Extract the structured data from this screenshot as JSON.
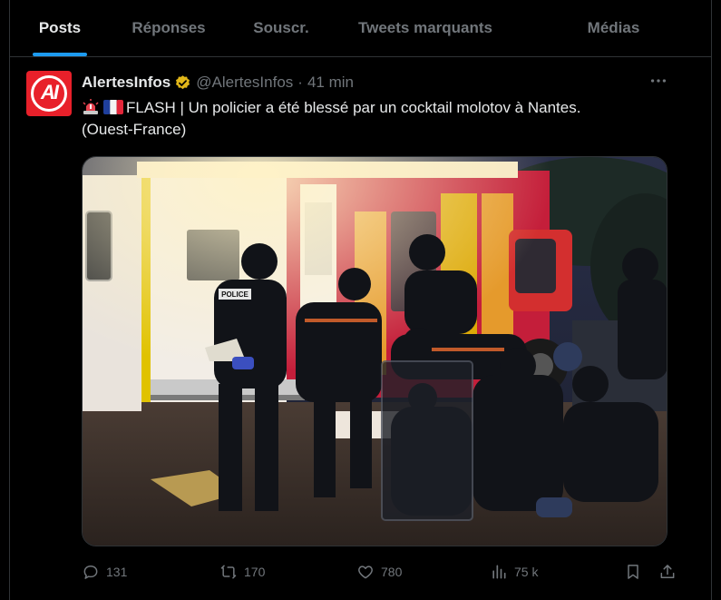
{
  "tabs": [
    {
      "label": "Posts",
      "active": true
    },
    {
      "label": "Réponses",
      "active": false
    },
    {
      "label": "Souscr.",
      "active": false
    },
    {
      "label": "Tweets marquants",
      "active": false
    },
    {
      "label": "Médias",
      "active": false
    }
  ],
  "tweet": {
    "avatar_text": "AI",
    "author_name": "AlertesInfos",
    "handle": "@AlertesInfos",
    "separator": "·",
    "time": "41 min",
    "more_icon": "more-horizontal-icon",
    "text_line1": "FLASH | Un policier a été blessé par un cocktail molotov à Nantes.",
    "text_line2": "(Ouest-France)",
    "media_badge": "POLICE"
  },
  "actions": {
    "replies": "131",
    "retweets": "170",
    "likes": "780",
    "views": "75 k"
  },
  "colors": {
    "accent": "#1d9bf0",
    "verified": "#e2b719",
    "brand_red": "#e8202a",
    "muted": "#71767b",
    "text": "#e7e9ea",
    "border": "#2f3336"
  }
}
